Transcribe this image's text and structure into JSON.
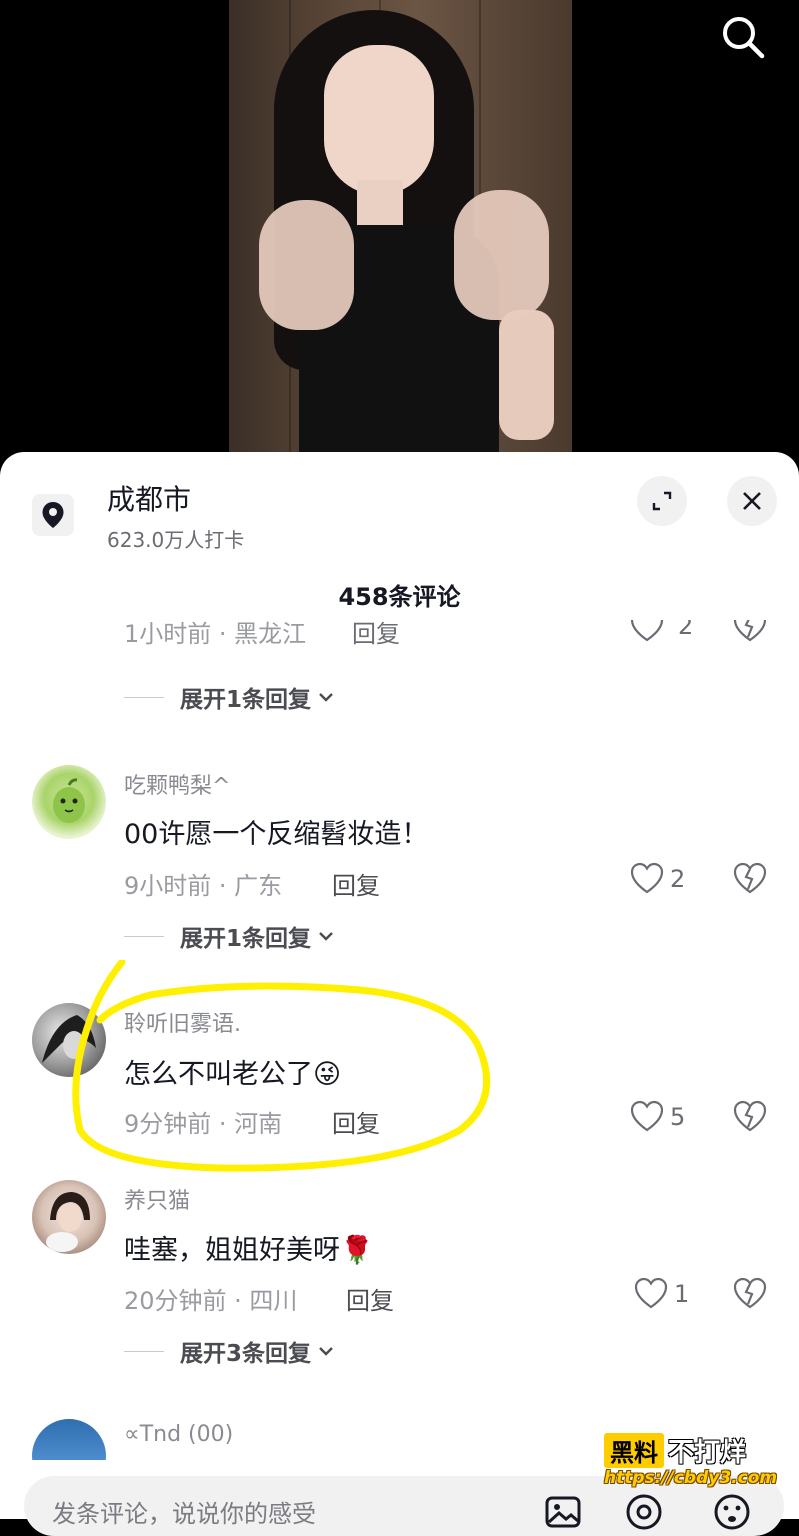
{
  "location": {
    "title": "成都市",
    "checkins": "623.0万人打卡"
  },
  "comment_count": "458条评论",
  "partial_comment": {
    "meta": "1小时前 · 黑龙江",
    "reply": "回复",
    "likes": "2"
  },
  "expand_1": "展开1条回复",
  "comments": [
    {
      "user": "吃颗鸭梨^",
      "text": "00许愿一个反缩髫妆造！",
      "meta": "9小时前 · 广东",
      "reply": "回复",
      "likes": "2",
      "expand": "展开1条回复"
    },
    {
      "user": "聆听旧雾语.",
      "text": "怎么不叫老公了",
      "emoji": "😜",
      "meta": "9分钟前 · 河南",
      "reply": "回复",
      "likes": "5"
    },
    {
      "user": "养只猫",
      "text": "哇塞，姐姐好美呀",
      "emoji": "🌹",
      "meta": "20分钟前 · 四川",
      "reply": "回复",
      "likes": "1",
      "expand": "展开3条回复"
    },
    {
      "user": "∝Tnd (00)"
    }
  ],
  "input": {
    "placeholder": "发条评论，说说你的感受"
  },
  "watermark": {
    "brand_a": "黑料",
    "brand_b": "不打烊",
    "url": "https://cbdy3.com"
  },
  "colors": {
    "highlight": "#ffef00",
    "sheet": "#ffffff",
    "text_primary": "#161823",
    "text_secondary": "#9a9ba0"
  }
}
